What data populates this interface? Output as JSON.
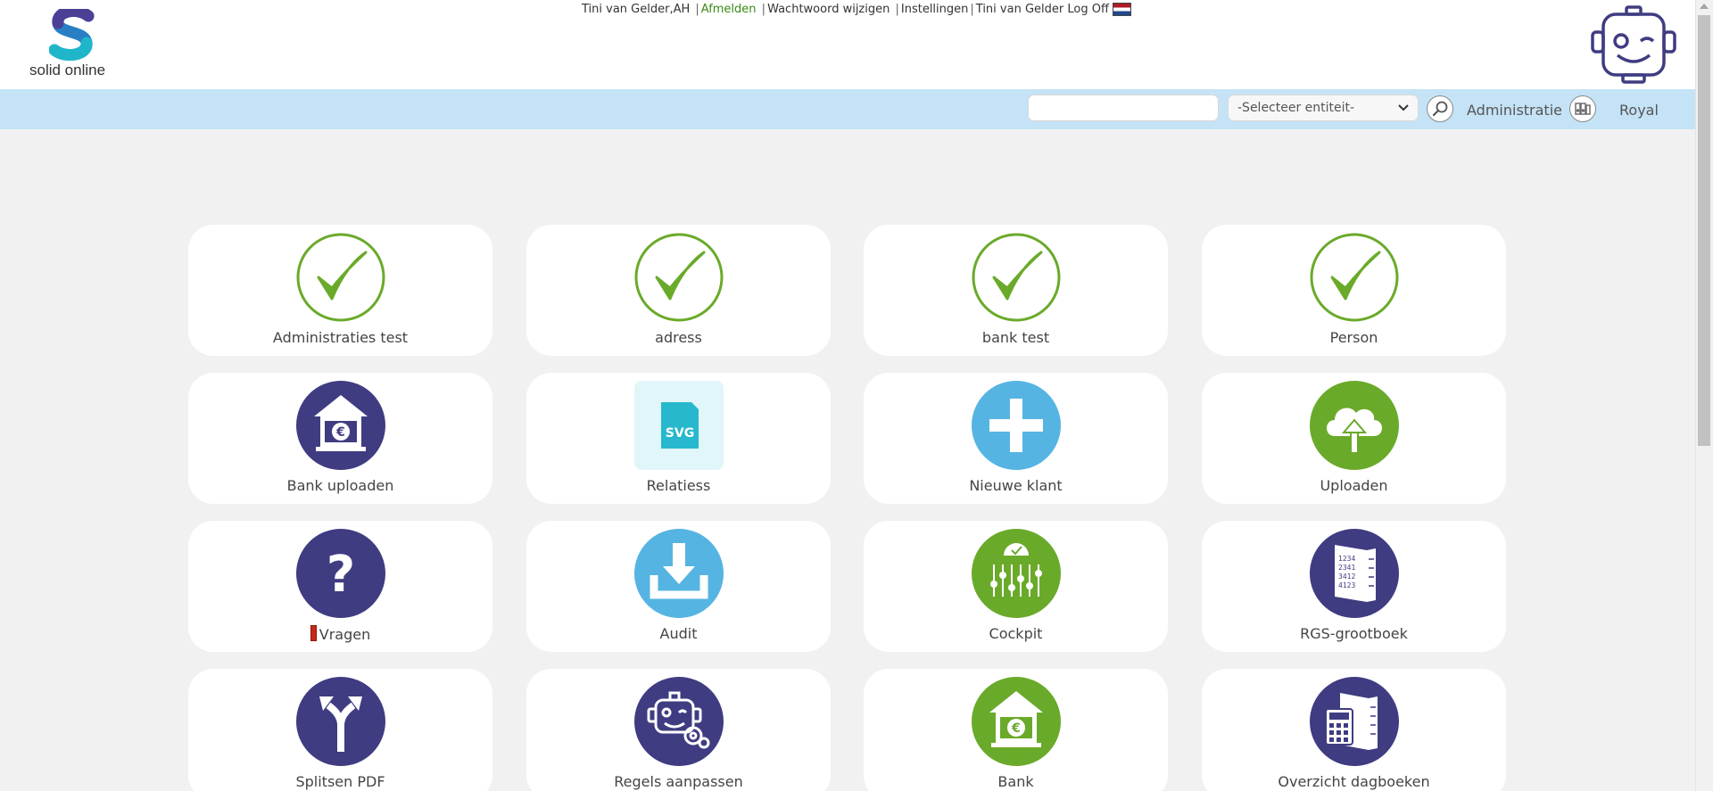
{
  "header": {
    "logo_text": "solid online",
    "top_links": [
      {
        "text": "Tini van Gelder,AH",
        "style": "plain"
      },
      {
        "text": "Afmelden",
        "style": "green"
      },
      {
        "text": "Wachtwoord wijzigen",
        "style": "plain"
      },
      {
        "text": "Instellingen",
        "style": "plain"
      },
      {
        "text": "Tini van Gelder Log Off",
        "style": "plain"
      }
    ],
    "flag_icon": "netherlands-flag-icon"
  },
  "navbar": {
    "search_value": "",
    "entity_select": "-Selecteer entiteit-",
    "administratie": "Administratie",
    "royal": "Royal"
  },
  "colors": {
    "accent_green": "#6aaa2a",
    "navy": "#3f3c82",
    "light_blue": "#56b4e3",
    "nav_bg": "#c5e3f6"
  },
  "tiles": [
    {
      "label": "Administraties test",
      "icon": "check-icon"
    },
    {
      "label": "adress",
      "icon": "check-icon"
    },
    {
      "label": "bank test",
      "icon": "check-icon"
    },
    {
      "label": "Person",
      "icon": "check-icon"
    },
    {
      "label": "Bank uploaden",
      "icon": "bank-euro-icon"
    },
    {
      "label": "Relatiess",
      "icon": "svg-file-icon",
      "icon_text": "SVG"
    },
    {
      "label": "Nieuwe klant",
      "icon": "plus-icon"
    },
    {
      "label": "Uploaden",
      "icon": "cloud-upload-icon"
    },
    {
      "label": "Vragen",
      "icon": "question-icon"
    },
    {
      "label": "Audit",
      "icon": "download-tray-icon"
    },
    {
      "label": "Cockpit",
      "icon": "cockpit-sliders-icon"
    },
    {
      "label": "RGS-grootboek",
      "icon": "ledger-book-icon",
      "icon_text": [
        "1234",
        "2341",
        "3412",
        "4123"
      ]
    },
    {
      "label": "Splitsen PDF",
      "icon": "split-arrows-icon"
    },
    {
      "label": "Regels aanpassen",
      "icon": "robot-gear-icon"
    },
    {
      "label": "Bank",
      "icon": "bank-euro-icon"
    },
    {
      "label": "Overzicht dagboeken",
      "icon": "calculator-book-icon"
    }
  ]
}
